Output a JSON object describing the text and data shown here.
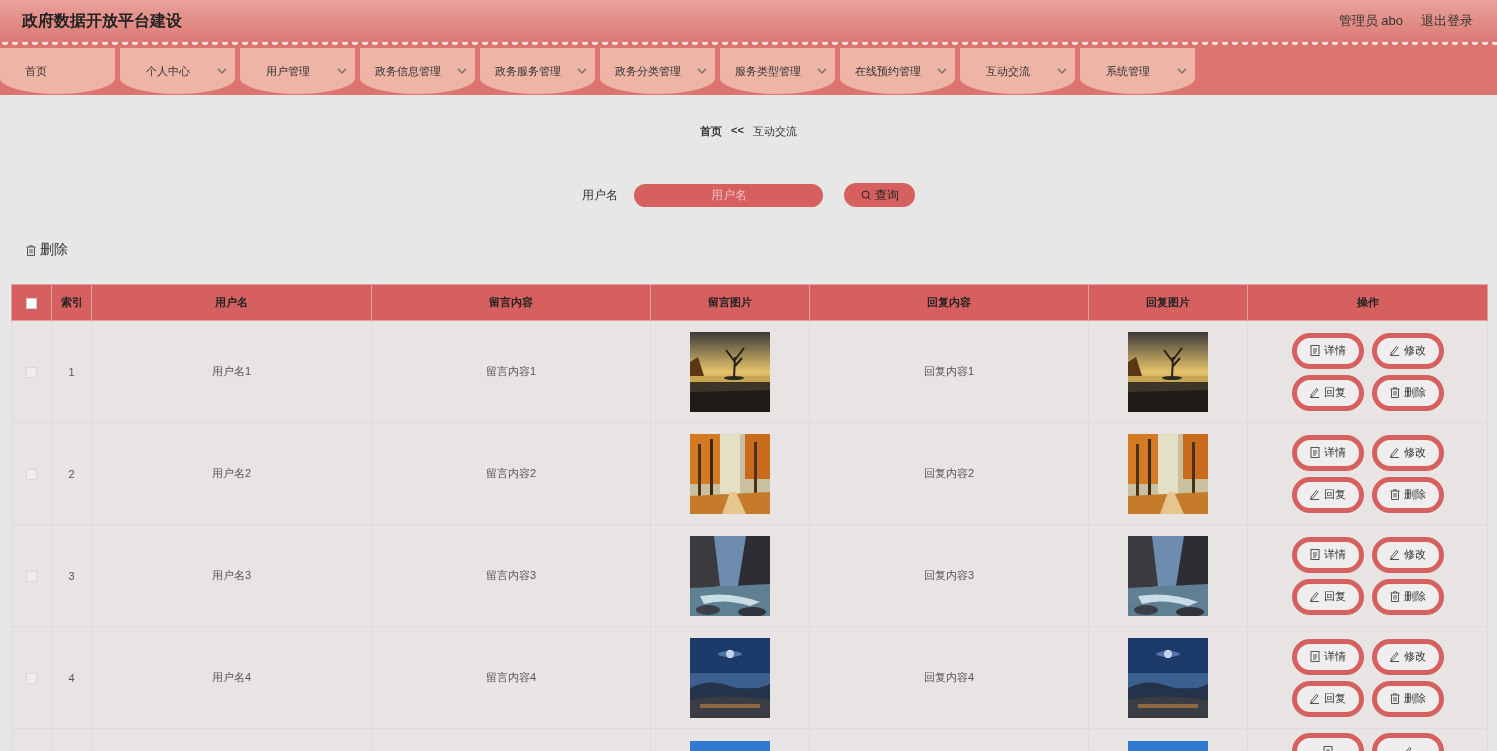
{
  "header": {
    "title": "政府数据开放平台建设",
    "user": "管理员 abo",
    "logout": "退出登录"
  },
  "nav": [
    {
      "label": "首页",
      "kind": "link"
    },
    {
      "label": "个人中心",
      "kind": "menu"
    },
    {
      "label": "用户管理",
      "kind": "menu"
    },
    {
      "label": "政务信息管理",
      "kind": "menu"
    },
    {
      "label": "政务服务管理",
      "kind": "menu"
    },
    {
      "label": "政务分类管理",
      "kind": "menu"
    },
    {
      "label": "服务类型管理",
      "kind": "menu"
    },
    {
      "label": "在线预约管理",
      "kind": "menu"
    },
    {
      "label": "互动交流",
      "kind": "menu"
    },
    {
      "label": "系统管理",
      "kind": "menu"
    }
  ],
  "breadcrumb": {
    "home": "首页",
    "separator": "<<",
    "current": "互动交流"
  },
  "search": {
    "label": "用户名",
    "placeholder": "用户名",
    "button": "查询"
  },
  "toolbar": {
    "delete": "删除"
  },
  "table": {
    "header_checked": false,
    "columns": [
      "索引",
      "用户名",
      "留言内容",
      "留言图片",
      "回复内容",
      "回复图片",
      "操作"
    ],
    "rows": [
      {
        "checked": false,
        "index": "1",
        "username": "用户名1",
        "content": "留言内容1",
        "message_image": {
          "kind": "picture"
        },
        "reply": "回复内容1",
        "reply_image": {
          "kind": "picture"
        },
        "actions": [
          {
            "kind": "detail",
            "label": "详情"
          },
          {
            "kind": "edit",
            "label": "修改"
          },
          {
            "kind": "reply",
            "label": "回复"
          },
          {
            "kind": "delete",
            "label": "删除"
          }
        ]
      },
      {
        "checked": false,
        "index": "2",
        "username": "用户名2",
        "content": "留言内容2",
        "message_image": {
          "kind": "picture"
        },
        "reply": "回复内容2",
        "reply_image": {
          "kind": "picture"
        },
        "actions": [
          {
            "kind": "detail",
            "label": "详情"
          },
          {
            "kind": "edit",
            "label": "修改"
          },
          {
            "kind": "reply",
            "label": "回复"
          },
          {
            "kind": "delete",
            "label": "删除"
          }
        ]
      },
      {
        "checked": false,
        "index": "3",
        "username": "用户名3",
        "content": "留言内容3",
        "message_image": {
          "kind": "picture"
        },
        "reply": "回复内容3",
        "reply_image": {
          "kind": "picture"
        },
        "actions": [
          {
            "kind": "detail",
            "label": "详情"
          },
          {
            "kind": "edit",
            "label": "修改"
          },
          {
            "kind": "reply",
            "label": "回复"
          },
          {
            "kind": "delete",
            "label": "删除"
          }
        ]
      },
      {
        "checked": false,
        "index": "4",
        "username": "用户名4",
        "content": "留言内容4",
        "message_image": {
          "kind": "picture"
        },
        "reply": "回复内容4",
        "reply_image": {
          "kind": "picture"
        },
        "actions": [
          {
            "kind": "detail",
            "label": "详情"
          },
          {
            "kind": "edit",
            "label": "修改"
          },
          {
            "kind": "reply",
            "label": "回复"
          },
          {
            "kind": "delete",
            "label": "删除"
          }
        ]
      },
      {
        "message_image": {
          "kind": "picture"
        },
        "reply_image": {
          "kind": "picture"
        },
        "actions": [
          {
            "kind": "detail"
          },
          {
            "kind": "edit"
          }
        ]
      }
    ]
  }
}
